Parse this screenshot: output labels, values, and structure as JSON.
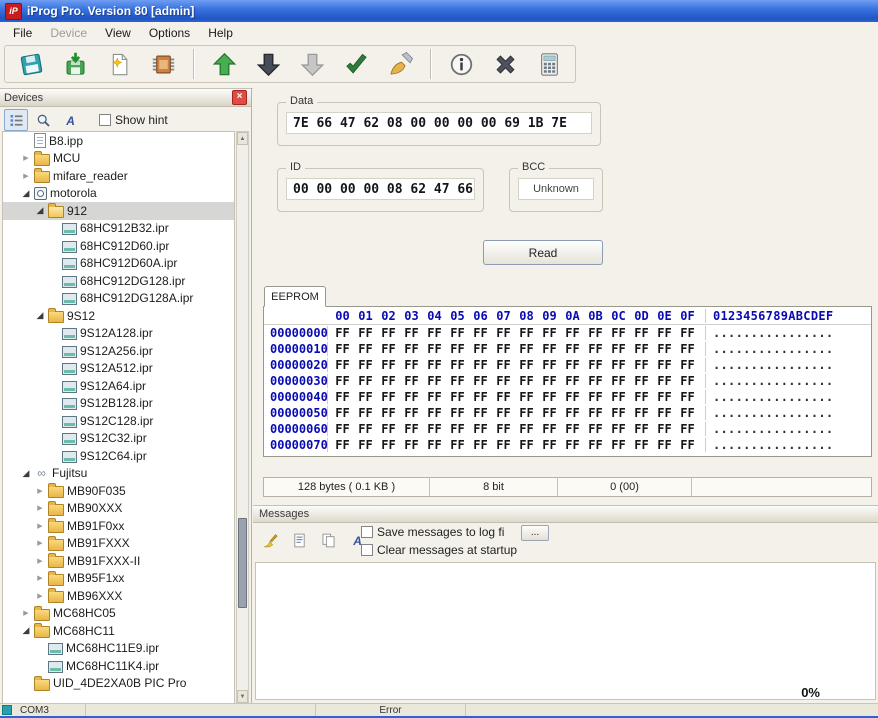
{
  "window": {
    "title": "iProg Pro. Version 80 [admin]",
    "logo_text": "iP"
  },
  "menu_bar": {
    "items": [
      {
        "label": "File",
        "enabled": true
      },
      {
        "label": "Device",
        "enabled": false
      },
      {
        "label": "View",
        "enabled": true
      },
      {
        "label": "Options",
        "enabled": true
      },
      {
        "label": "Help",
        "enabled": true
      }
    ]
  },
  "toolbar": {
    "groups": [
      [
        "open-file-icon",
        "save-file-icon",
        "new-file-icon",
        "chip-icon"
      ],
      [
        "upload-icon",
        "download-icon",
        "download-alt-icon",
        "verify-icon",
        "erase-icon"
      ],
      [
        "info-icon",
        "cancel-icon",
        "calculator-icon"
      ]
    ]
  },
  "devices_panel": {
    "title": "Devices",
    "show_hint_label": "Show hint",
    "toolbar_icons": [
      "tree-view-icon",
      "search-icon",
      "font-icon"
    ],
    "tree": [
      {
        "label": "B8.ipp",
        "depth": 1,
        "icon": "file",
        "state": "none"
      },
      {
        "label": "MCU",
        "depth": 1,
        "icon": "folder",
        "state": "collapsed"
      },
      {
        "label": "mifare_reader",
        "depth": 1,
        "icon": "folder",
        "state": "collapsed"
      },
      {
        "label": "motorola",
        "depth": 1,
        "icon": "motorola",
        "state": "expanded"
      },
      {
        "label": "912",
        "depth": 2,
        "icon": "folder-open",
        "state": "expanded",
        "selected": true
      },
      {
        "label": "68HC912B32.ipr",
        "depth": 3,
        "icon": "chip",
        "state": "none"
      },
      {
        "label": "68HC912D60.ipr",
        "depth": 3,
        "icon": "chip",
        "state": "none"
      },
      {
        "label": "68HC912D60A.ipr",
        "depth": 3,
        "icon": "chip",
        "state": "none"
      },
      {
        "label": "68HC912DG128.ipr",
        "depth": 3,
        "icon": "chip",
        "state": "none"
      },
      {
        "label": "68HC912DG128A.ipr",
        "depth": 3,
        "icon": "chip",
        "state": "none"
      },
      {
        "label": "9S12",
        "depth": 2,
        "icon": "folder",
        "state": "expanded"
      },
      {
        "label": "9S12A128.ipr",
        "depth": 3,
        "icon": "chip",
        "state": "none"
      },
      {
        "label": "9S12A256.ipr",
        "depth": 3,
        "icon": "chip",
        "state": "none"
      },
      {
        "label": "9S12A512.ipr",
        "depth": 3,
        "icon": "chip",
        "state": "none"
      },
      {
        "label": "9S12A64.ipr",
        "depth": 3,
        "icon": "chip",
        "state": "none"
      },
      {
        "label": "9S12B128.ipr",
        "depth": 3,
        "icon": "chip",
        "state": "none"
      },
      {
        "label": "9S12C128.ipr",
        "depth": 3,
        "icon": "chip",
        "state": "none"
      },
      {
        "label": "9S12C32.ipr",
        "depth": 3,
        "icon": "chip",
        "state": "none"
      },
      {
        "label": "9S12C64.ipr",
        "depth": 3,
        "icon": "chip",
        "state": "none"
      },
      {
        "label": "Fujitsu",
        "depth": 1,
        "icon": "loop",
        "state": "expanded"
      },
      {
        "label": "MB90F035",
        "depth": 2,
        "icon": "folder",
        "state": "collapsed"
      },
      {
        "label": "MB90XXX",
        "depth": 2,
        "icon": "folder",
        "state": "collapsed"
      },
      {
        "label": "MB91F0xx",
        "depth": 2,
        "icon": "folder",
        "state": "collapsed"
      },
      {
        "label": "MB91FXXX",
        "depth": 2,
        "icon": "folder",
        "state": "collapsed"
      },
      {
        "label": "MB91FXXX-II",
        "depth": 2,
        "icon": "folder",
        "state": "collapsed"
      },
      {
        "label": "MB95F1xx",
        "depth": 2,
        "icon": "folder",
        "state": "collapsed"
      },
      {
        "label": "MB96XXX",
        "depth": 2,
        "icon": "folder",
        "state": "collapsed"
      },
      {
        "label": "MC68HC05",
        "depth": 1,
        "icon": "folder",
        "state": "collapsed"
      },
      {
        "label": "MC68HC11",
        "depth": 1,
        "icon": "folder",
        "state": "expanded"
      },
      {
        "label": "MC68HC11E9.ipr",
        "depth": 2,
        "icon": "chip",
        "state": "none"
      },
      {
        "label": "MC68HC11K4.ipr",
        "depth": 2,
        "icon": "chip",
        "state": "none"
      },
      {
        "label": "UID_4DE2XA0B PIC Pro",
        "depth": 1,
        "icon": "folder",
        "state": "none"
      }
    ]
  },
  "data_group": {
    "label": "Data",
    "value": "7E 66 47 62 08 00 00 00 00 69 1B 7E"
  },
  "id_group": {
    "label": "ID",
    "value": "00 00 00 00 08 62 47 66"
  },
  "bcc_group": {
    "label": "BCC",
    "value": "Unknown"
  },
  "read_button_label": "Read",
  "eeprom": {
    "tab_label": "EEPROM",
    "column_headers": [
      "00",
      "01",
      "02",
      "03",
      "04",
      "05",
      "06",
      "07",
      "08",
      "09",
      "0A",
      "0B",
      "0C",
      "0D",
      "0E",
      "0F"
    ],
    "ascii_header": "0123456789ABCDEF",
    "rows": [
      {
        "addr": "00000000",
        "bytes": [
          "FF",
          "FF",
          "FF",
          "FF",
          "FF",
          "FF",
          "FF",
          "FF",
          "FF",
          "FF",
          "FF",
          "FF",
          "FF",
          "FF",
          "FF",
          "FF"
        ],
        "ascii": "................"
      },
      {
        "addr": "00000010",
        "bytes": [
          "FF",
          "FF",
          "FF",
          "FF",
          "FF",
          "FF",
          "FF",
          "FF",
          "FF",
          "FF",
          "FF",
          "FF",
          "FF",
          "FF",
          "FF",
          "FF"
        ],
        "ascii": "................"
      },
      {
        "addr": "00000020",
        "bytes": [
          "FF",
          "FF",
          "FF",
          "FF",
          "FF",
          "FF",
          "FF",
          "FF",
          "FF",
          "FF",
          "FF",
          "FF",
          "FF",
          "FF",
          "FF",
          "FF"
        ],
        "ascii": "................"
      },
      {
        "addr": "00000030",
        "bytes": [
          "FF",
          "FF",
          "FF",
          "FF",
          "FF",
          "FF",
          "FF",
          "FF",
          "FF",
          "FF",
          "FF",
          "FF",
          "FF",
          "FF",
          "FF",
          "FF"
        ],
        "ascii": "................"
      },
      {
        "addr": "00000040",
        "bytes": [
          "FF",
          "FF",
          "FF",
          "FF",
          "FF",
          "FF",
          "FF",
          "FF",
          "FF",
          "FF",
          "FF",
          "FF",
          "FF",
          "FF",
          "FF",
          "FF"
        ],
        "ascii": "................"
      },
      {
        "addr": "00000050",
        "bytes": [
          "FF",
          "FF",
          "FF",
          "FF",
          "FF",
          "FF",
          "FF",
          "FF",
          "FF",
          "FF",
          "FF",
          "FF",
          "FF",
          "FF",
          "FF",
          "FF"
        ],
        "ascii": "................"
      },
      {
        "addr": "00000060",
        "bytes": [
          "FF",
          "FF",
          "FF",
          "FF",
          "FF",
          "FF",
          "FF",
          "FF",
          "FF",
          "FF",
          "FF",
          "FF",
          "FF",
          "FF",
          "FF",
          "FF"
        ],
        "ascii": "................"
      },
      {
        "addr": "00000070",
        "bytes": [
          "FF",
          "FF",
          "FF",
          "FF",
          "FF",
          "FF",
          "FF",
          "FF",
          "FF",
          "FF",
          "FF",
          "FF",
          "FF",
          "FF",
          "FF",
          "FF"
        ],
        "ascii": "................"
      }
    ],
    "status": {
      "size": "128 bytes ( 0.1 KB )",
      "word": "8 bit",
      "position": "0 (00)"
    }
  },
  "messages_panel": {
    "title": "Messages",
    "toolbar_icons": [
      "clear-messages-icon",
      "log-icon",
      "copy-icon",
      "font-icon"
    ],
    "save_checkbox_label": "Save messages to log fi",
    "browse_button_label": "...",
    "clear_checkbox_label": "Clear messages at startup",
    "progress": "0%"
  },
  "status_bar": {
    "port": "COM3",
    "error_label": "Error"
  }
}
